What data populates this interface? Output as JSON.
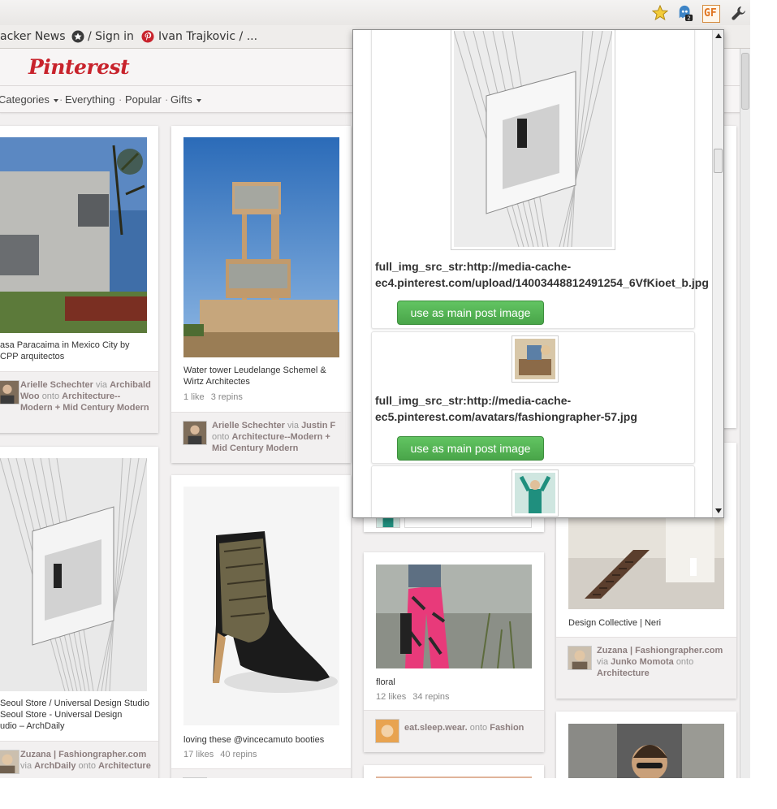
{
  "bookmarks": [
    {
      "label": "acker News"
    },
    {
      "label": "/ Sign in",
      "icon": "github-icon"
    },
    {
      "label": "Ivan Trajkovic / ...",
      "icon": "pinterest-icon"
    }
  ],
  "extensions": {
    "gf_label": "GF",
    "badge_count": "2"
  },
  "site": {
    "logo": "Pinterest",
    "brand_color": "#c8232c",
    "nav": {
      "categories": "Categories",
      "everything": "Everything",
      "popular": "Popular",
      "gifts": "Gifts",
      "separator": "·"
    }
  },
  "pins": [
    {
      "description": "asa Paracaima in Mexico City by\nCPP arquitectos",
      "attribution": {
        "user": "Arielle Schechter",
        "via_word": "via",
        "via": "Archibald Woo",
        "onto_word": "onto",
        "board": "Architecture--Modern + Mid Century Modern"
      }
    },
    {
      "description": "Water tower Leudelange Schemel &\nWirtz Architectes",
      "likes": "1 like",
      "repins": "3 repins",
      "attribution": {
        "user": "Arielle Schechter",
        "via_word": "via",
        "via": "Justin F",
        "onto_word": "onto",
        "board": "Architecture--Modern + Mid Century Modern"
      }
    },
    {
      "description": "Seoul Store / Universal Design Studio\nSeoul Store - Universal Design\nudio – ArchDaily",
      "attribution": {
        "user": "Zuzana | Fashiongrapher.com",
        "via_word": "via",
        "via": "ArchDaily",
        "onto_word": "onto",
        "board": "Architecture"
      }
    },
    {
      "description": "loving these @vincecamuto booties",
      "likes": "17 likes",
      "repins": "40 repins"
    },
    {
      "description": "floral",
      "likes": "12 likes",
      "repins": "34 repins",
      "attribution": {
        "user": "eat.sleep.wear.",
        "onto_word": "onto",
        "board": "Fashion"
      }
    },
    {
      "description": "Design Collective | Neri",
      "attribution": {
        "user": "Zuzana | Fashiongrapher.com",
        "via_word": "via",
        "via": "Junko Momota",
        "onto_word": "onto",
        "board": "Architecture"
      }
    }
  ],
  "popup": {
    "items": [
      {
        "src_text": "full_img_src_str:http://media-cache-\nec4.pinterest.com/upload/14003448812491254_6VfKioet_b.jpg",
        "button": "use as main post image"
      },
      {
        "src_text": "full_img_src_str:http://media-cache-\nec5.pinterest.com/avatars/fashiongrapher-57.jpg",
        "button": "use as main post image"
      },
      {
        "src_text": "",
        "button": ""
      }
    ]
  }
}
